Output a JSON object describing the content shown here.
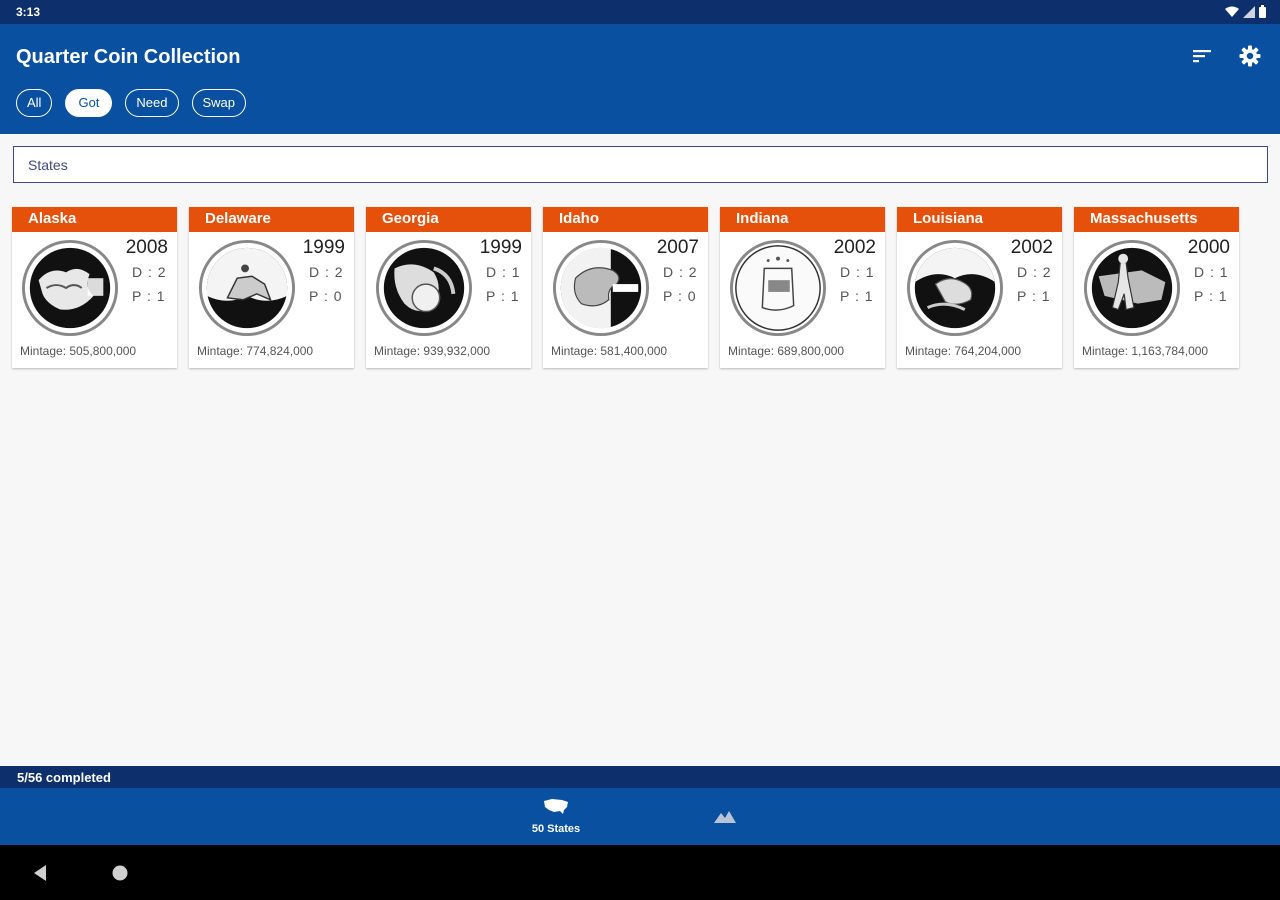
{
  "status_bar": {
    "time": "3:13"
  },
  "app": {
    "title": "Quarter Coin Collection",
    "actions": [
      {
        "name": "sort-icon"
      },
      {
        "name": "settings-icon"
      }
    ],
    "filters": [
      {
        "label": "All",
        "active": false
      },
      {
        "label": "Got",
        "active": true
      },
      {
        "label": "Need",
        "active": false
      },
      {
        "label": "Swap",
        "active": false
      }
    ]
  },
  "search": {
    "value": "States",
    "placeholder": "States"
  },
  "coins": [
    {
      "state": "Alaska",
      "year": "2008",
      "d": "D : 2",
      "p": "P : 1",
      "mintage": "Mintage: 505,800,000"
    },
    {
      "state": "Delaware",
      "year": "1999",
      "d": "D : 2",
      "p": "P : 0",
      "mintage": "Mintage: 774,824,000"
    },
    {
      "state": "Georgia",
      "year": "1999",
      "d": "D : 1",
      "p": "P : 1",
      "mintage": "Mintage: 939,932,000"
    },
    {
      "state": "Idaho",
      "year": "2007",
      "d": "D : 2",
      "p": "P : 0",
      "mintage": "Mintage: 581,400,000"
    },
    {
      "state": "Indiana",
      "year": "2002",
      "d": "D : 1",
      "p": "P : 1",
      "mintage": "Mintage: 689,800,000"
    },
    {
      "state": "Louisiana",
      "year": "2002",
      "d": "D : 2",
      "p": "P : 1",
      "mintage": "Mintage: 764,204,000"
    },
    {
      "state": "Massachusetts",
      "year": "2000",
      "d": "D : 1",
      "p": "P : 1",
      "mintage": "Mintage: 1,163,784,000"
    }
  ],
  "progress": {
    "text": "5/56 completed"
  },
  "bottom_nav": [
    {
      "label": "50 States",
      "icon": "usa-map-icon"
    },
    {
      "label": "",
      "icon": "mountains-icon"
    }
  ],
  "colors": {
    "primary": "#0950a1",
    "primary_dark": "#0d2f6b",
    "accent": "#e5500b"
  }
}
